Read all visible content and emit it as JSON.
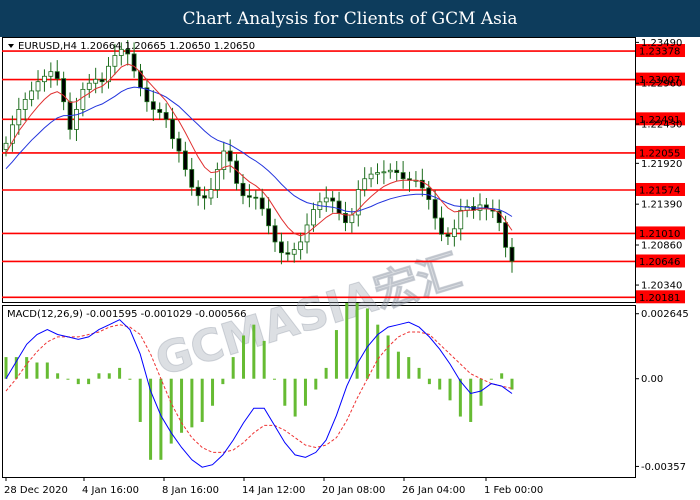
{
  "title": "Chart Analysis for Clients of GCM Asia",
  "symbol_line": "EURUSD,H4  1.20664 1.20665 1.20650 1.20650",
  "watermark": "GCMASIA宏汇",
  "macd_label": "MACD(12,26,9) -0.001595 -0.001029 -0.000566",
  "colors": {
    "header_bg": "#0d3c5c",
    "level_line": "#ff0000",
    "level_box": "#ff0000",
    "ma_fast": "#e03030",
    "ma_slow": "#2233dd",
    "candle": "#1a6b1a",
    "histogram": "#66bb33",
    "macd_line": "#0000ff",
    "signal_line": "#ee3333"
  },
  "chart_data": {
    "type": "line",
    "title": "",
    "price_axis_ticks": [
      "1.23490",
      "1.22960",
      "1.22430",
      "1.21920",
      "1.21390",
      "1.20860",
      "1.20340"
    ],
    "levels": [
      "1.23378",
      "1.23007",
      "1.22491",
      "1.22055",
      "1.21574",
      "1.21010",
      "1.20646",
      "1.20181"
    ],
    "x_tick_labels": [
      "28 Dec 2020",
      "4 Jan 16:00",
      "8 Jan 16:00",
      "14 Jan 12:00",
      "20 Jan 08:00",
      "26 Jan 04:00",
      "1 Feb 00:00"
    ],
    "price_ylim": [
      1.2012,
      1.2356
    ],
    "close": [
      1.2218,
      1.2242,
      1.2262,
      1.2275,
      1.2286,
      1.2298,
      1.2305,
      1.2311,
      1.2302,
      1.2272,
      1.2236,
      1.2262,
      1.2288,
      1.2296,
      1.2301,
      1.2298,
      1.2318,
      1.2332,
      1.234,
      1.2334,
      1.2312,
      1.229,
      1.2272,
      1.2262,
      1.2258,
      1.2249,
      1.2224,
      1.2208,
      1.2184,
      1.2161,
      1.215,
      1.2147,
      1.2158,
      1.2184,
      1.2208,
      1.2195,
      1.2166,
      1.215,
      1.2148,
      1.2147,
      1.2133,
      1.2111,
      1.209,
      1.2076,
      1.2074,
      1.208,
      1.209,
      1.2112,
      1.2132,
      1.2142,
      1.2147,
      1.2143,
      1.2127,
      1.2115,
      1.2125,
      1.2158,
      1.2172,
      1.2178,
      1.218,
      1.2181,
      1.2183,
      1.218,
      1.2172,
      1.217,
      1.217,
      1.216,
      1.2145,
      1.2121,
      1.21,
      1.2097,
      1.2107,
      1.2131,
      1.2136,
      1.2131,
      1.2138,
      1.2133,
      1.213,
      1.2115,
      1.2083,
      1.2065
    ],
    "ma_fast": [
      1.2205,
      1.222,
      1.2234,
      1.2245,
      1.2256,
      1.2266,
      1.2275,
      1.2282,
      1.2285,
      1.228,
      1.2271,
      1.2272,
      1.2278,
      1.2283,
      1.2289,
      1.2292,
      1.2299,
      1.2308,
      1.2317,
      1.2321,
      1.2318,
      1.231,
      1.23,
      1.2291,
      1.2282,
      1.2273,
      1.226,
      1.2247,
      1.2232,
      1.2216,
      1.22,
      1.2187,
      1.218,
      1.2181,
      1.2187,
      1.2189,
      1.2183,
      1.2175,
      1.2168,
      1.2163,
      1.2156,
      1.2146,
      1.2133,
      1.212,
      1.2109,
      1.2101,
      1.2098,
      1.2101,
      1.2108,
      1.2115,
      1.2122,
      1.2127,
      1.2127,
      1.2125,
      1.2125,
      1.2132,
      1.2141,
      1.2149,
      1.2156,
      1.2162,
      1.2166,
      1.2169,
      1.217,
      1.217,
      1.217,
      1.2168,
      1.2163,
      1.2154,
      1.2143,
      1.2134,
      1.2129,
      1.213,
      1.2131,
      1.2131,
      1.2133,
      1.2133,
      1.2132,
      1.2128,
      1.2117,
      1.2105
    ],
    "ma_slow": [
      1.2185,
      1.2194,
      1.2204,
      1.2213,
      1.2222,
      1.223,
      1.2238,
      1.2245,
      1.2251,
      1.2254,
      1.2254,
      1.2255,
      1.2258,
      1.2262,
      1.2266,
      1.2269,
      1.2274,
      1.2279,
      1.2285,
      1.2289,
      1.2291,
      1.229,
      1.2288,
      1.2285,
      1.2282,
      1.2278,
      1.2272,
      1.2266,
      1.2258,
      1.225,
      1.2242,
      1.2234,
      1.2227,
      1.2222,
      1.2219,
      1.2216,
      1.2211,
      1.2206,
      1.22,
      1.2195,
      1.2189,
      1.2182,
      1.2174,
      1.2165,
      1.2157,
      1.215,
      1.2145,
      1.2141,
      1.2139,
      1.2137,
      1.2136,
      1.2135,
      1.2133,
      1.213,
      1.2129,
      1.213,
      1.2133,
      1.2136,
      1.214,
      1.2143,
      1.2146,
      1.2148,
      1.215,
      1.2151,
      1.2152,
      1.2152,
      1.2151,
      1.2148,
      1.2144,
      1.214,
      1.2137,
      1.2136,
      1.2135,
      1.2134,
      1.2134,
      1.2134,
      1.2133,
      1.2132,
      1.2128,
      1.2123
    ],
    "macd_axis_ticks": [
      "0.002645",
      "0.00",
      "-0.00357"
    ],
    "macd_ylim": [
      -0.004,
      0.003
    ],
    "macd": [
      0.0,
      0.0007,
      0.0014,
      0.0018,
      0.002,
      0.0018,
      0.0017,
      0.0016,
      0.0017,
      0.002,
      0.0022,
      0.0024,
      0.002,
      0.001,
      -0.0005,
      -0.0015,
      -0.0022,
      -0.0028,
      -0.0033,
      -0.0036,
      -0.0035,
      -0.0031,
      -0.0025,
      -0.0018,
      -0.0012,
      -0.0012,
      -0.0019,
      -0.0026,
      -0.0031,
      -0.0032,
      -0.003,
      -0.0025,
      -0.0015,
      -0.0003,
      0.0006,
      0.0013,
      0.0018,
      0.0021,
      0.0022,
      0.0023,
      0.0021,
      0.0017,
      0.0012,
      0.0006,
      -0.0001,
      -0.0006,
      -0.0005,
      -0.0002,
      -0.0003,
      -0.0006
    ],
    "signal": [
      -0.0005,
      0.0,
      0.0006,
      0.0011,
      0.0015,
      0.0017,
      0.0017,
      0.0017,
      0.0018,
      0.0019,
      0.0021,
      0.0022,
      0.0021,
      0.0018,
      0.001,
      0.0,
      -0.001,
      -0.0018,
      -0.0024,
      -0.0028,
      -0.003,
      -0.003,
      -0.0029,
      -0.0026,
      -0.0022,
      -0.0019,
      -0.0019,
      -0.0021,
      -0.0024,
      -0.0027,
      -0.0028,
      -0.0027,
      -0.0024,
      -0.0017,
      -0.0008,
      0.0,
      0.0008,
      0.0013,
      0.0017,
      0.0019,
      0.0019,
      0.0018,
      0.0014,
      0.001,
      0.0006,
      0.0002,
      0.0,
      -0.0002,
      -0.0003,
      -0.0004
    ],
    "histogram": [
      0.0004,
      0.0004,
      0.0004,
      0.0003,
      0.0003,
      0.0001,
      0.0,
      -0.0001,
      -0.0001,
      0.0001,
      0.0001,
      0.0002,
      0.0,
      -0.0008,
      -0.0015,
      -0.0015,
      -0.0012,
      -0.001,
      -0.0009,
      -0.0008,
      -0.0005,
      -0.0001,
      0.0004,
      0.0008,
      0.001,
      0.0007,
      0.0,
      -0.0005,
      -0.0007,
      -0.0005,
      -0.0002,
      0.0002,
      0.0009,
      0.0014,
      0.0014,
      0.0013,
      0.001,
      0.0008,
      0.0005,
      0.0004,
      0.0002,
      -0.0001,
      -0.0002,
      -0.0004,
      -0.0007,
      -0.0008,
      -0.0005,
      0.0,
      0.0001,
      -0.0002
    ]
  }
}
